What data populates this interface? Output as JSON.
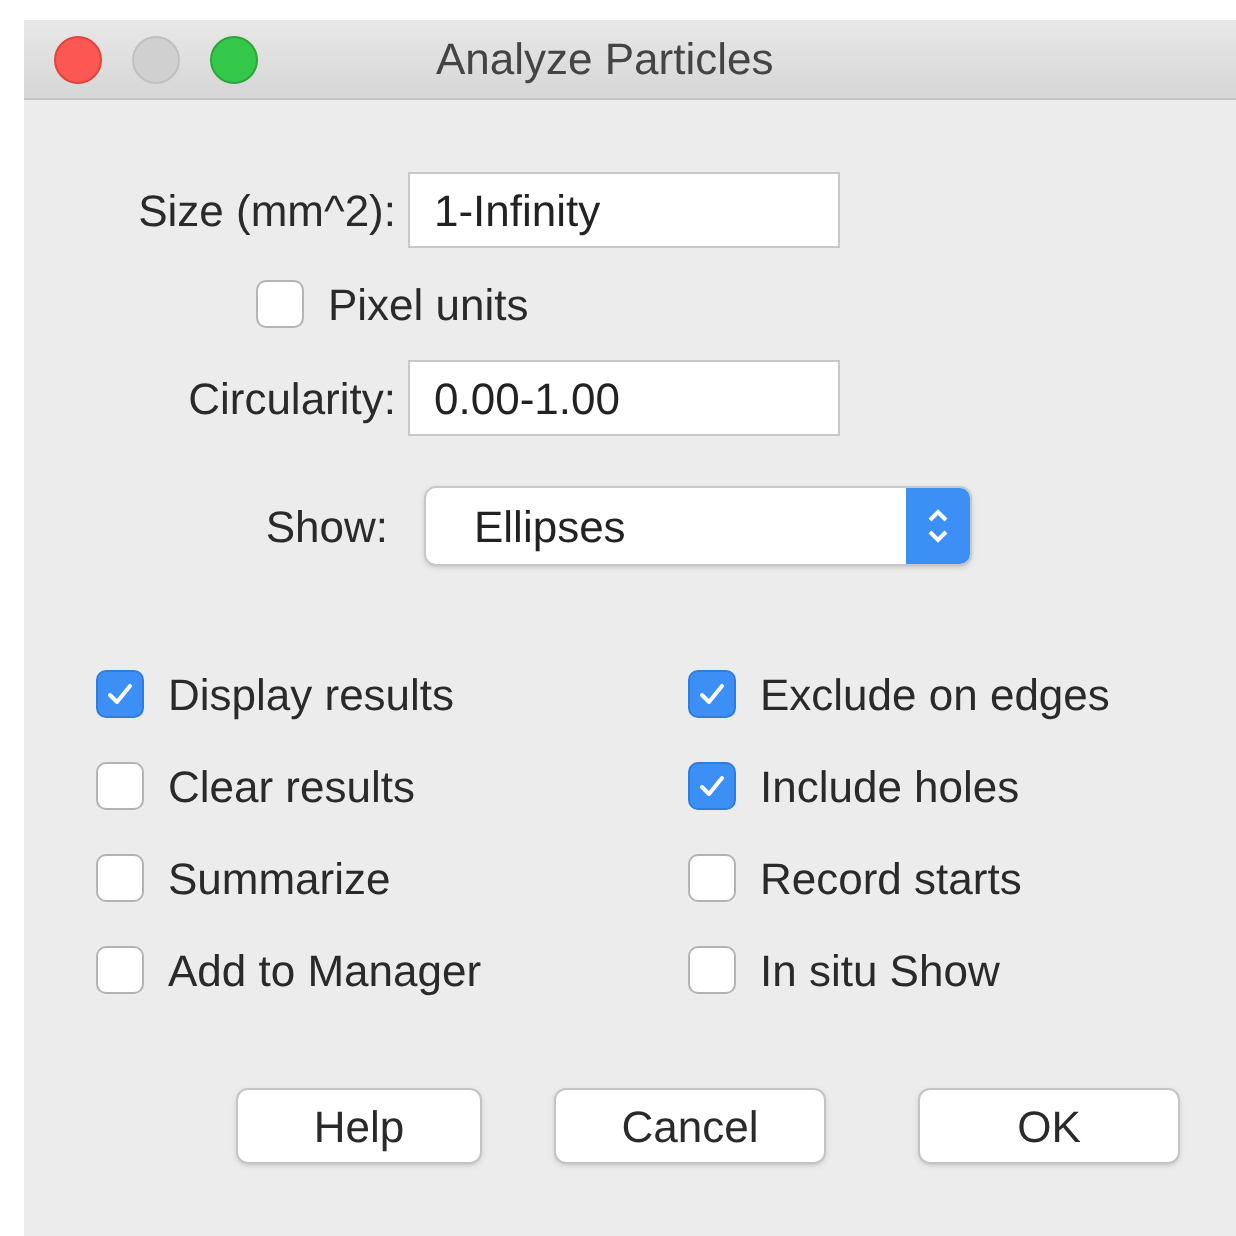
{
  "window": {
    "title": "Analyze Particles"
  },
  "size": {
    "label": "Size (mm^2):",
    "value": "1-Infinity"
  },
  "pixel_units": {
    "label": "Pixel units",
    "checked": false
  },
  "circularity": {
    "label": "Circularity:",
    "value": "0.00-1.00"
  },
  "show": {
    "label": "Show:",
    "value": "Ellipses"
  },
  "options": [
    {
      "label": "Display results",
      "checked": true
    },
    {
      "label": "Exclude on edges",
      "checked": true
    },
    {
      "label": "Clear results",
      "checked": false
    },
    {
      "label": "Include holes",
      "checked": true
    },
    {
      "label": "Summarize",
      "checked": false
    },
    {
      "label": "Record starts",
      "checked": false
    },
    {
      "label": "Add to Manager",
      "checked": false
    },
    {
      "label": "In situ Show",
      "checked": false
    }
  ],
  "buttons": [
    "Help",
    "Cancel",
    "OK"
  ]
}
